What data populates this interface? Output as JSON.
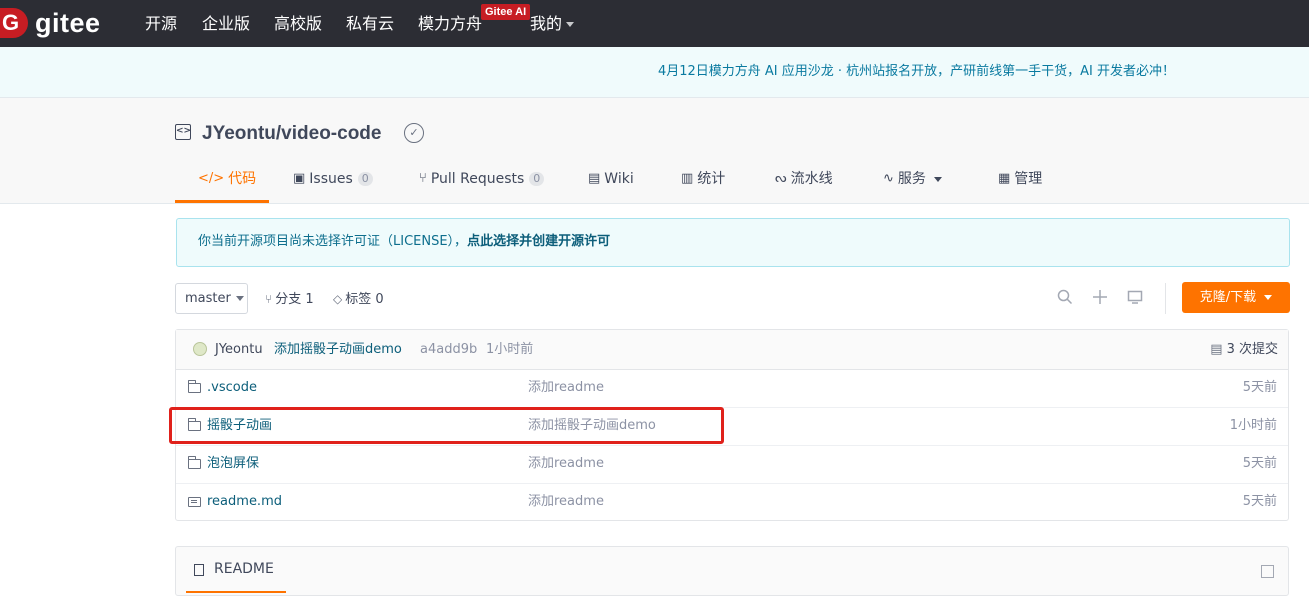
{
  "topnav": {
    "logo_letter": "G",
    "logo_text": "gitee",
    "items": [
      "开源",
      "企业版",
      "高校版",
      "私有云",
      "模力方舟"
    ],
    "ai_badge": "Gitee AI",
    "mine": "我的"
  },
  "announcement": "4月12日模力方舟 AI 应用沙龙 · 杭州站报名开放，产研前线第一手干货，AI 开发者必冲！",
  "repo": {
    "title": "JYeontu/video-code",
    "tabs": [
      {
        "label": "代码",
        "icon": "code-icon",
        "active": true
      },
      {
        "label": "Issues",
        "count": "0",
        "icon": "issues-icon"
      },
      {
        "label": "Pull Requests",
        "count": "0",
        "icon": "pull-request-icon"
      },
      {
        "label": "Wiki",
        "icon": "wiki-icon"
      },
      {
        "label": "统计",
        "icon": "stats-icon"
      },
      {
        "label": "流水线",
        "icon": "pipeline-icon"
      },
      {
        "label": "服务",
        "icon": "service-icon"
      },
      {
        "label": "管理",
        "icon": "manage-icon"
      }
    ]
  },
  "license": {
    "text": "你当前开源项目尚未选择许可证（LICENSE），",
    "link": "点此选择并创建开源许可"
  },
  "toolbar": {
    "branch": "master",
    "branches": "分支 1",
    "tags": "标签 0",
    "clone_label": "克隆/下载"
  },
  "commit": {
    "author": "JYeontu",
    "message": "添加摇骰子动画demo",
    "hash": "a4add9b",
    "time": "1小时前",
    "count": "3 次提交"
  },
  "files": [
    {
      "name": ".vscode",
      "type": "folder",
      "message": "添加readme",
      "time": "5天前"
    },
    {
      "name": "摇骰子动画",
      "type": "folder",
      "message": "添加摇骰子动画demo",
      "time": "1小时前"
    },
    {
      "name": "泡泡屏保",
      "type": "folder",
      "message": "添加readme",
      "time": "5天前"
    },
    {
      "name": "readme.md",
      "type": "file",
      "message": "添加readme",
      "time": "5天前"
    }
  ],
  "readme": {
    "label": "README"
  },
  "colors": {
    "accent": "#fe7300",
    "nav_bg": "#2c2d34",
    "brand": "#c71d23",
    "highlight": "#e0211b"
  }
}
